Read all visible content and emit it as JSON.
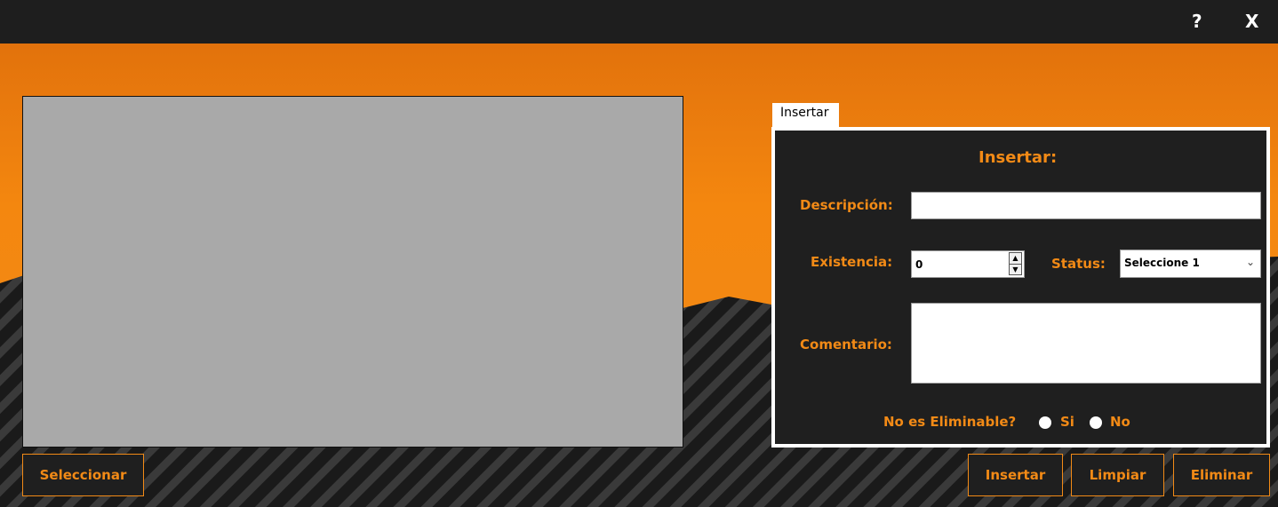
{
  "titlebar": {
    "help_label": "?",
    "close_label": "X"
  },
  "left": {
    "select_button": "Seleccionar"
  },
  "tab": {
    "label": "Insertar"
  },
  "form": {
    "heading": "Insertar:",
    "descripcion_label": "Descripción:",
    "descripcion_value": "",
    "existencia_label": "Existencia:",
    "existencia_value": "0",
    "status_label": "Status:",
    "status_selected": "Seleccione 1",
    "comentario_label": "Comentario:",
    "comentario_value": "",
    "eliminable_label": "No es Eliminable?",
    "option_si": "Si",
    "option_no": "No"
  },
  "actions": {
    "insert": "Insertar",
    "clear": "Limpiar",
    "delete": "Eliminar"
  },
  "colors": {
    "accent": "#f28a16",
    "dark": "#1f1f1f",
    "grid_bg": "#a9a9a9"
  }
}
